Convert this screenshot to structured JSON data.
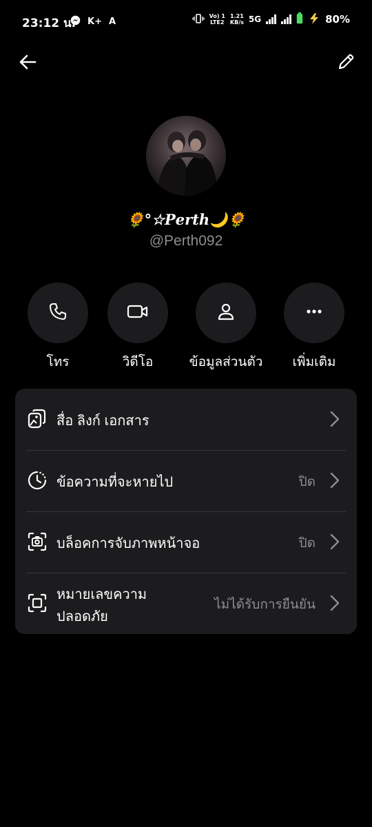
{
  "status_bar": {
    "time": "23:12 น.",
    "app_icons": [
      "messenger-icon",
      "k-plus-icon",
      "a-icon"
    ],
    "volte_top": "Vo) 1",
    "volte_bottom": "LTE2",
    "speed_top": "1.21",
    "speed_bottom": "KB/s",
    "network": "5G",
    "battery_percent": "80%",
    "battery_color": "#4cd964"
  },
  "nav": {
    "back_icon": "arrow-left-icon",
    "edit_icon": "pencil-icon"
  },
  "profile": {
    "display_name": "🌻°☆𝑷𝒆𝒓𝒕𝒉🌙🌻",
    "username": "@Perth092"
  },
  "actions": [
    {
      "label": "โทร",
      "icon": "phone-icon"
    },
    {
      "label": "วิดีโอ",
      "icon": "video-camera-icon"
    },
    {
      "label": "ข้อมูลส่วนตัว",
      "icon": "person-icon"
    },
    {
      "label": "เพิ่มเติม",
      "icon": "more-dots-icon"
    }
  ],
  "settings": [
    {
      "label": "สื่อ ลิงก์ เอกสาร",
      "value": "",
      "icon": "media-gallery-icon"
    },
    {
      "label": "ข้อความที่จะหายไป",
      "value": "ปิด",
      "icon": "disappearing-timer-icon"
    },
    {
      "label": "บล็อคการจับภาพหน้าจอ",
      "value": "ปิด",
      "icon": "screenshot-camera-icon"
    },
    {
      "label": "หมายเลขความปลอดภัย",
      "value": "ไม่ได้รับการยืนยัน",
      "icon": "safety-number-icon"
    }
  ],
  "colors": {
    "background": "#000000",
    "card": "#1c1c1e",
    "secondary_text": "#8e8e93"
  }
}
